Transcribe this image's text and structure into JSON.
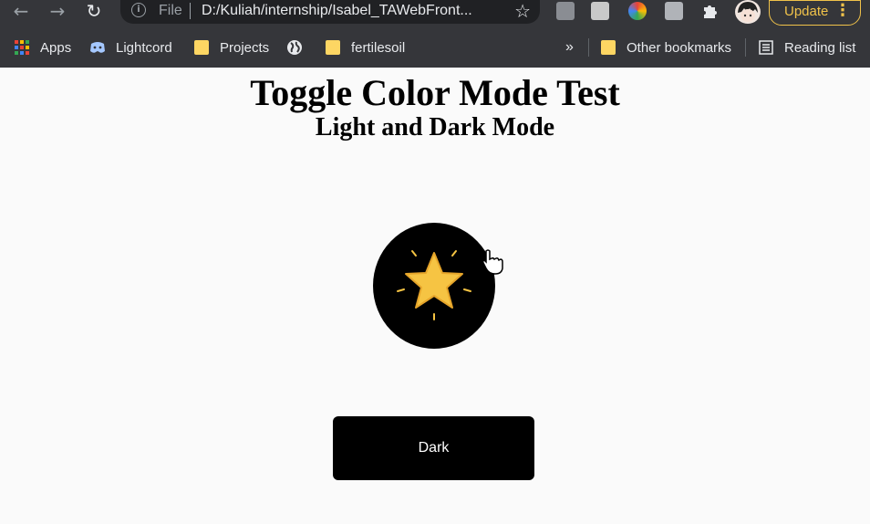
{
  "browser": {
    "url_scheme": "File",
    "url": "D:/Kuliah/internship/Isabel_TAWebFront...",
    "update_label": "Update",
    "accent": "#f0c24a"
  },
  "bookmarks": {
    "apps": "Apps",
    "items": [
      "Lightcord",
      "Projects",
      "fertilesoil"
    ],
    "overflow": "»",
    "other": "Other bookmarks",
    "reading_list": "Reading list"
  },
  "page": {
    "title": "Toggle Color Mode Test",
    "subtitle": "Light and Dark Mode",
    "toggle_icon": "star-icon",
    "button_label": "Dark"
  }
}
